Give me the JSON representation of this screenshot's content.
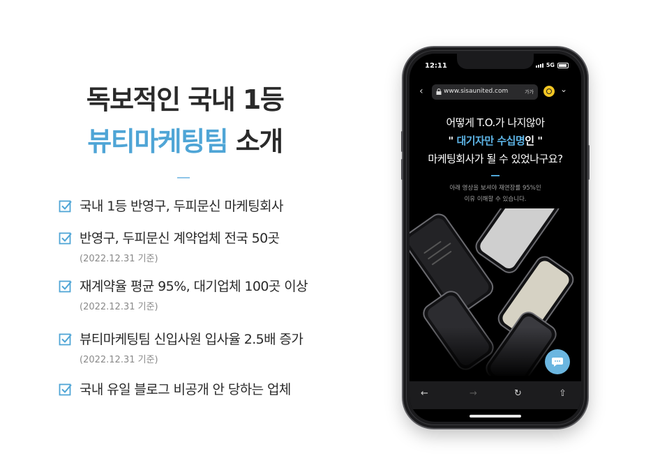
{
  "headline": {
    "line1": "독보적인 국내 1등",
    "line2_accent": "뷰티마케팅팀",
    "line2_rest": " 소개"
  },
  "features": [
    {
      "text": "국내 1등 반영구, 두피문신 마케팅회사",
      "note": ""
    },
    {
      "text": "반영구, 두피문신 계약업체 전국 50곳",
      "note": "(2022.12.31 기준)"
    },
    {
      "text": "재계약율 평균 95%, 대기업체 100곳 이상",
      "note": "(2022.12.31 기준)"
    },
    {
      "text": "뷰티마케팅팀 신입사원 입사율 2.5배 증가",
      "note": "(2022.12.31 기준)"
    },
    {
      "text": "국내 유일 블로그 비공개 안 당하는 업체",
      "note": ""
    }
  ],
  "phone": {
    "status": {
      "time": "12:11",
      "network": "5G"
    },
    "browser": {
      "url": "www.sisaunited.com",
      "text_size": "가가"
    },
    "page": {
      "q1": "어떻게 T.O.가 나지않아",
      "q2_open": "\" ",
      "q2_highlight": "대기자만 수십명",
      "q2_close": "인 \"",
      "q3": "마케팅회사가 될 수 있었나구요?",
      "sub1": "아래 영상을 보셔야 재연장률 95%인",
      "sub2": "이유 이해할 수 있습니다."
    },
    "toolbar": [
      "back-arrow",
      "forward-arrow",
      "reload",
      "share"
    ]
  },
  "colors": {
    "accent": "#4fa5d6",
    "text": "#2a2a2a",
    "note": "#8a8a8a"
  }
}
